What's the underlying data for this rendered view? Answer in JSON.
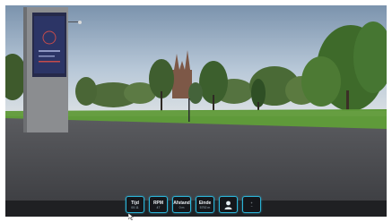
{
  "hud": {
    "stats": [
      {
        "label": "Tijd",
        "value": "00:11"
      },
      {
        "label": "RPM",
        "value": "47"
      },
      {
        "label": "Afstand",
        "value": "0 m"
      },
      {
        "label": "Einde",
        "value": "5792 m"
      }
    ],
    "profile_icon": "user-icon",
    "extra_button": {
      "top": "+",
      "bottom": "−"
    }
  },
  "colors": {
    "accent": "#2bb4d8",
    "hud_bg": "#1f2023",
    "sky": "#b8cde0",
    "grass": "#5f9a3a",
    "plaza": "#4b4c50"
  }
}
